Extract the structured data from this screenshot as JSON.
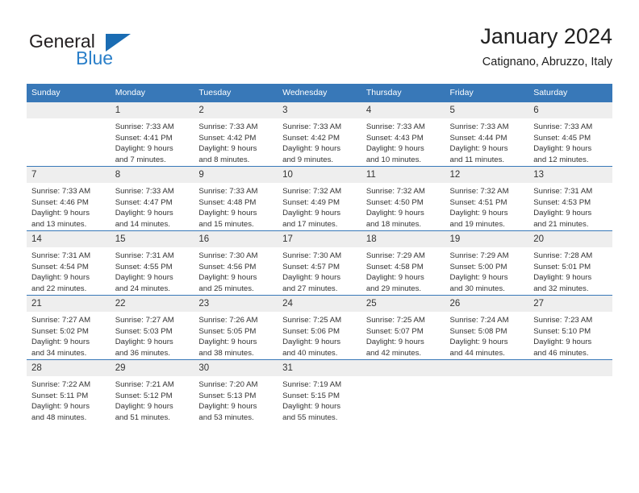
{
  "logo": {
    "word_one": "General",
    "word_two": "Blue",
    "icon": "triangle-mark"
  },
  "header": {
    "title": "January 2024",
    "subtitle": "Catignano, Abruzzo, Italy"
  },
  "calendar": {
    "weekday_headers": [
      "Sunday",
      "Monday",
      "Tuesday",
      "Wednesday",
      "Thursday",
      "Friday",
      "Saturday"
    ],
    "accent_color": "#3878b8",
    "daynum_background": "#eeeeee",
    "weeks": [
      [
        {
          "day": "",
          "lines": []
        },
        {
          "day": "1",
          "lines": [
            "Sunrise: 7:33 AM",
            "Sunset: 4:41 PM",
            "Daylight: 9 hours",
            "and 7 minutes."
          ]
        },
        {
          "day": "2",
          "lines": [
            "Sunrise: 7:33 AM",
            "Sunset: 4:42 PM",
            "Daylight: 9 hours",
            "and 8 minutes."
          ]
        },
        {
          "day": "3",
          "lines": [
            "Sunrise: 7:33 AM",
            "Sunset: 4:42 PM",
            "Daylight: 9 hours",
            "and 9 minutes."
          ]
        },
        {
          "day": "4",
          "lines": [
            "Sunrise: 7:33 AM",
            "Sunset: 4:43 PM",
            "Daylight: 9 hours",
            "and 10 minutes."
          ]
        },
        {
          "day": "5",
          "lines": [
            "Sunrise: 7:33 AM",
            "Sunset: 4:44 PM",
            "Daylight: 9 hours",
            "and 11 minutes."
          ]
        },
        {
          "day": "6",
          "lines": [
            "Sunrise: 7:33 AM",
            "Sunset: 4:45 PM",
            "Daylight: 9 hours",
            "and 12 minutes."
          ]
        }
      ],
      [
        {
          "day": "7",
          "lines": [
            "Sunrise: 7:33 AM",
            "Sunset: 4:46 PM",
            "Daylight: 9 hours",
            "and 13 minutes."
          ]
        },
        {
          "day": "8",
          "lines": [
            "Sunrise: 7:33 AM",
            "Sunset: 4:47 PM",
            "Daylight: 9 hours",
            "and 14 minutes."
          ]
        },
        {
          "day": "9",
          "lines": [
            "Sunrise: 7:33 AM",
            "Sunset: 4:48 PM",
            "Daylight: 9 hours",
            "and 15 minutes."
          ]
        },
        {
          "day": "10",
          "lines": [
            "Sunrise: 7:32 AM",
            "Sunset: 4:49 PM",
            "Daylight: 9 hours",
            "and 17 minutes."
          ]
        },
        {
          "day": "11",
          "lines": [
            "Sunrise: 7:32 AM",
            "Sunset: 4:50 PM",
            "Daylight: 9 hours",
            "and 18 minutes."
          ]
        },
        {
          "day": "12",
          "lines": [
            "Sunrise: 7:32 AM",
            "Sunset: 4:51 PM",
            "Daylight: 9 hours",
            "and 19 minutes."
          ]
        },
        {
          "day": "13",
          "lines": [
            "Sunrise: 7:31 AM",
            "Sunset: 4:53 PM",
            "Daylight: 9 hours",
            "and 21 minutes."
          ]
        }
      ],
      [
        {
          "day": "14",
          "lines": [
            "Sunrise: 7:31 AM",
            "Sunset: 4:54 PM",
            "Daylight: 9 hours",
            "and 22 minutes."
          ]
        },
        {
          "day": "15",
          "lines": [
            "Sunrise: 7:31 AM",
            "Sunset: 4:55 PM",
            "Daylight: 9 hours",
            "and 24 minutes."
          ]
        },
        {
          "day": "16",
          "lines": [
            "Sunrise: 7:30 AM",
            "Sunset: 4:56 PM",
            "Daylight: 9 hours",
            "and 25 minutes."
          ]
        },
        {
          "day": "17",
          "lines": [
            "Sunrise: 7:30 AM",
            "Sunset: 4:57 PM",
            "Daylight: 9 hours",
            "and 27 minutes."
          ]
        },
        {
          "day": "18",
          "lines": [
            "Sunrise: 7:29 AM",
            "Sunset: 4:58 PM",
            "Daylight: 9 hours",
            "and 29 minutes."
          ]
        },
        {
          "day": "19",
          "lines": [
            "Sunrise: 7:29 AM",
            "Sunset: 5:00 PM",
            "Daylight: 9 hours",
            "and 30 minutes."
          ]
        },
        {
          "day": "20",
          "lines": [
            "Sunrise: 7:28 AM",
            "Sunset: 5:01 PM",
            "Daylight: 9 hours",
            "and 32 minutes."
          ]
        }
      ],
      [
        {
          "day": "21",
          "lines": [
            "Sunrise: 7:27 AM",
            "Sunset: 5:02 PM",
            "Daylight: 9 hours",
            "and 34 minutes."
          ]
        },
        {
          "day": "22",
          "lines": [
            "Sunrise: 7:27 AM",
            "Sunset: 5:03 PM",
            "Daylight: 9 hours",
            "and 36 minutes."
          ]
        },
        {
          "day": "23",
          "lines": [
            "Sunrise: 7:26 AM",
            "Sunset: 5:05 PM",
            "Daylight: 9 hours",
            "and 38 minutes."
          ]
        },
        {
          "day": "24",
          "lines": [
            "Sunrise: 7:25 AM",
            "Sunset: 5:06 PM",
            "Daylight: 9 hours",
            "and 40 minutes."
          ]
        },
        {
          "day": "25",
          "lines": [
            "Sunrise: 7:25 AM",
            "Sunset: 5:07 PM",
            "Daylight: 9 hours",
            "and 42 minutes."
          ]
        },
        {
          "day": "26",
          "lines": [
            "Sunrise: 7:24 AM",
            "Sunset: 5:08 PM",
            "Daylight: 9 hours",
            "and 44 minutes."
          ]
        },
        {
          "day": "27",
          "lines": [
            "Sunrise: 7:23 AM",
            "Sunset: 5:10 PM",
            "Daylight: 9 hours",
            "and 46 minutes."
          ]
        }
      ],
      [
        {
          "day": "28",
          "lines": [
            "Sunrise: 7:22 AM",
            "Sunset: 5:11 PM",
            "Daylight: 9 hours",
            "and 48 minutes."
          ]
        },
        {
          "day": "29",
          "lines": [
            "Sunrise: 7:21 AM",
            "Sunset: 5:12 PM",
            "Daylight: 9 hours",
            "and 51 minutes."
          ]
        },
        {
          "day": "30",
          "lines": [
            "Sunrise: 7:20 AM",
            "Sunset: 5:13 PM",
            "Daylight: 9 hours",
            "and 53 minutes."
          ]
        },
        {
          "day": "31",
          "lines": [
            "Sunrise: 7:19 AM",
            "Sunset: 5:15 PM",
            "Daylight: 9 hours",
            "and 55 minutes."
          ]
        },
        {
          "day": "",
          "lines": []
        },
        {
          "day": "",
          "lines": []
        },
        {
          "day": "",
          "lines": []
        }
      ]
    ]
  }
}
